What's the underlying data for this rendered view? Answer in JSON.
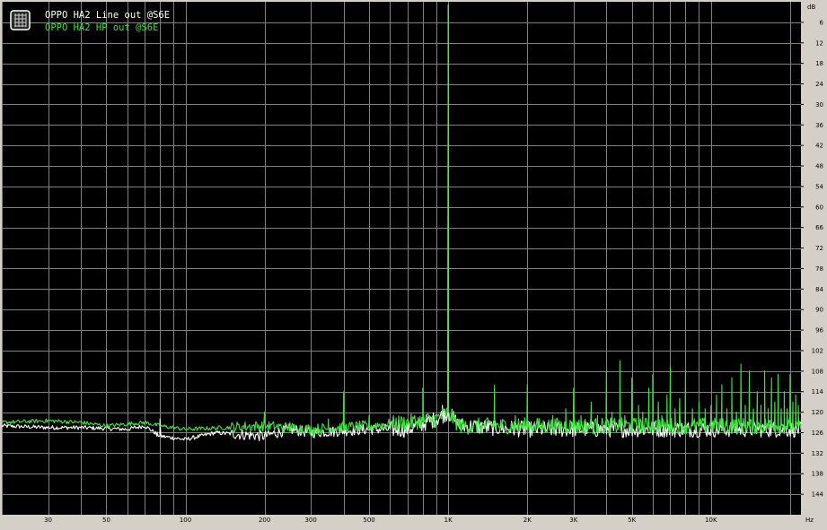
{
  "chart_data": {
    "type": "line",
    "title": "",
    "xlabel": "",
    "ylabel": "",
    "x_unit": "Hz",
    "y_unit": "dB",
    "x_scale": "log",
    "xlim": [
      20,
      22000
    ],
    "ylim": [
      0,
      -150
    ],
    "grid": true,
    "legend_position": "top-left",
    "background": "#000000",
    "grid_color": "#808080",
    "x_ticks": [
      {
        "value": 30,
        "label": "30"
      },
      {
        "value": 50,
        "label": "50"
      },
      {
        "value": 100,
        "label": "100"
      },
      {
        "value": 200,
        "label": "200"
      },
      {
        "value": 300,
        "label": "300"
      },
      {
        "value": 500,
        "label": "500"
      },
      {
        "value": 1000,
        "label": "1K"
      },
      {
        "value": 2000,
        "label": "2K"
      },
      {
        "value": 3000,
        "label": "3K"
      },
      {
        "value": 5000,
        "label": "5K"
      },
      {
        "value": 10000,
        "label": "10K"
      }
    ],
    "x_grid_values": [
      20,
      30,
      40,
      50,
      60,
      70,
      80,
      90,
      100,
      200,
      300,
      400,
      500,
      600,
      700,
      800,
      900,
      1000,
      2000,
      3000,
      4000,
      5000,
      6000,
      7000,
      8000,
      9000,
      10000,
      20000
    ],
    "y_ticks": [
      {
        "value": -6,
        "label": "6"
      },
      {
        "value": -12,
        "label": "12"
      },
      {
        "value": -18,
        "label": "18"
      },
      {
        "value": -24,
        "label": "24"
      },
      {
        "value": -30,
        "label": "30"
      },
      {
        "value": -36,
        "label": "36"
      },
      {
        "value": -42,
        "label": "42"
      },
      {
        "value": -48,
        "label": "48"
      },
      {
        "value": -54,
        "label": "54"
      },
      {
        "value": -60,
        "label": "60"
      },
      {
        "value": -66,
        "label": "66"
      },
      {
        "value": -72,
        "label": "72"
      },
      {
        "value": -78,
        "label": "78"
      },
      {
        "value": -84,
        "label": "84"
      },
      {
        "value": -90,
        "label": "90"
      },
      {
        "value": -96,
        "label": "96"
      },
      {
        "value": -102,
        "label": "102"
      },
      {
        "value": -108,
        "label": "108"
      },
      {
        "value": -114,
        "label": "114"
      },
      {
        "value": -120,
        "label": "120"
      },
      {
        "value": -126,
        "label": "126"
      },
      {
        "value": -132,
        "label": "132"
      },
      {
        "value": -138,
        "label": "138"
      },
      {
        "value": -144,
        "label": "144"
      }
    ],
    "series": [
      {
        "name": "OPPO HA2 Line out @S6E",
        "color": "#ffffff",
        "baseline": [
          [
            20,
            -124
          ],
          [
            30,
            -124.5
          ],
          [
            40,
            -124.5
          ],
          [
            60,
            -125
          ],
          [
            70,
            -124
          ],
          [
            80,
            -127
          ],
          [
            100,
            -128
          ],
          [
            130,
            -126
          ],
          [
            200,
            -127
          ],
          [
            250,
            -125
          ],
          [
            300,
            -126
          ],
          [
            500,
            -125
          ],
          [
            700,
            -125
          ],
          [
            900,
            -122
          ],
          [
            1000,
            -120
          ],
          [
            1100,
            -124
          ],
          [
            2000,
            -125
          ],
          [
            5000,
            -125
          ],
          [
            10000,
            -125
          ],
          [
            20000,
            -125
          ],
          [
            22000,
            -125
          ]
        ],
        "peaks": [
          [
            80,
            -122
          ],
          [
            950,
            -118
          ],
          [
            1000,
            -1
          ],
          [
            3000,
            -120
          ]
        ]
      },
      {
        "name": "OPPO HA2 HP out @S6E",
        "color": "#3ce63c",
        "baseline": [
          [
            20,
            -123
          ],
          [
            30,
            -122.5
          ],
          [
            40,
            -123
          ],
          [
            50,
            -124
          ],
          [
            70,
            -123
          ],
          [
            80,
            -124
          ],
          [
            100,
            -125
          ],
          [
            200,
            -124
          ],
          [
            300,
            -125
          ],
          [
            500,
            -124
          ],
          [
            700,
            -123
          ],
          [
            900,
            -122
          ],
          [
            1000,
            -120
          ],
          [
            1100,
            -124
          ],
          [
            2000,
            -124
          ],
          [
            5000,
            -124
          ],
          [
            10000,
            -124
          ],
          [
            20000,
            -124
          ],
          [
            22000,
            -124
          ]
        ],
        "peaks": [
          [
            200,
            -120
          ],
          [
            250,
            -123
          ],
          [
            350,
            -122
          ],
          [
            400,
            -114
          ],
          [
            500,
            -121
          ],
          [
            800,
            -113
          ],
          [
            1000,
            -1
          ],
          [
            1100,
            -122
          ],
          [
            1500,
            -112
          ],
          [
            1800,
            -121
          ],
          [
            2000,
            -112
          ],
          [
            2500,
            -121
          ],
          [
            2800,
            -119
          ],
          [
            3000,
            -113
          ],
          [
            3200,
            -121
          ],
          [
            3500,
            -117
          ],
          [
            3700,
            -121
          ],
          [
            4000,
            -108
          ],
          [
            4200,
            -120
          ],
          [
            4500,
            -105
          ],
          [
            4700,
            -121
          ],
          [
            5000,
            -110
          ],
          [
            5300,
            -118
          ],
          [
            5500,
            -120
          ],
          [
            5800,
            -113
          ],
          [
            6000,
            -109
          ],
          [
            6300,
            -117
          ],
          [
            6500,
            -121
          ],
          [
            6800,
            -115
          ],
          [
            7000,
            -107
          ],
          [
            7300,
            -119
          ],
          [
            7600,
            -116
          ],
          [
            8000,
            -108
          ],
          [
            8500,
            -119
          ],
          [
            9000,
            -117
          ],
          [
            9500,
            -119
          ],
          [
            10000,
            -118
          ],
          [
            10500,
            -115
          ],
          [
            11000,
            -112
          ],
          [
            11500,
            -119
          ],
          [
            12000,
            -110
          ],
          [
            12500,
            -120
          ],
          [
            13000,
            -106
          ],
          [
            13500,
            -118
          ],
          [
            14000,
            -108
          ],
          [
            14500,
            -119
          ],
          [
            15000,
            -114
          ],
          [
            15500,
            -118
          ],
          [
            16000,
            -108
          ],
          [
            16500,
            -119
          ],
          [
            17000,
            -110
          ],
          [
            17500,
            -117
          ],
          [
            18000,
            -109
          ],
          [
            18500,
            -119
          ],
          [
            19000,
            -114
          ],
          [
            19500,
            -119
          ],
          [
            20000,
            -109
          ],
          [
            20500,
            -117
          ],
          [
            21000,
            -115
          ],
          [
            21500,
            -118
          ]
        ]
      }
    ]
  },
  "axis": {
    "y_unit_label": "dB",
    "x_unit_label": "Hz"
  },
  "legend": {
    "icon": "grid-icon",
    "items": [
      {
        "label": "OPPO HA2 Line out @S6E",
        "color": "#ffffff"
      },
      {
        "label": "OPPO HA2 HP out @S6E",
        "color": "#3ce63c"
      }
    ]
  }
}
